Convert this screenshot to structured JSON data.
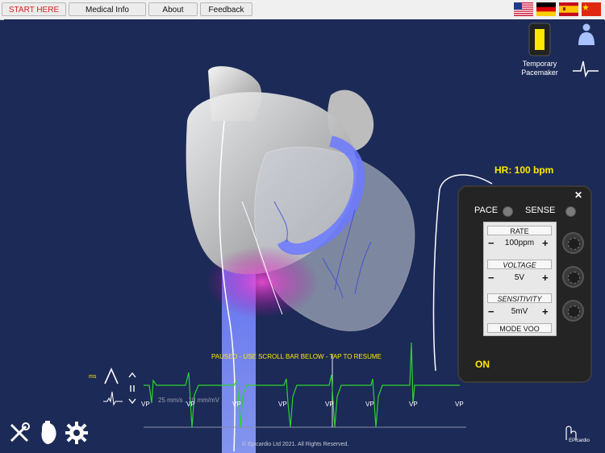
{
  "nav": {
    "start_here": "START HERE",
    "medical_info": "Medical Info",
    "about": "About",
    "feedback": "Feedback"
  },
  "flags": [
    "us-flag-icon",
    "de-flag-icon",
    "es-flag-icon",
    "cn-flag-icon"
  ],
  "side": {
    "temp_pacemaker_line1": "Temporary",
    "temp_pacemaker_line2": "Pacemaker"
  },
  "heart_rate": "HR: 100 bpm",
  "pacer": {
    "close": "✕",
    "pace_label": "PACE",
    "sense_label": "SENSE",
    "rate_label": "RATE",
    "rate_value": "100ppm",
    "voltage_label": "VOLTAGE",
    "voltage_value": "5V",
    "sensitivity_label": "SENSITIVITY",
    "sensitivity_value": "5mV",
    "mode_label": "MODE VOO",
    "on_label": "ON",
    "minus": "−",
    "plus": "+"
  },
  "ecg": {
    "paused_message": "PAUSED - USE SCROLL BAR BELOW - TAP TO RESUME",
    "ms_label": "ms",
    "speed_label": "25 mm/s , 10 mm/mV",
    "vp_markers": [
      "VP",
      "VP",
      "VP",
      "VP",
      "VP",
      "VP",
      "VP",
      "VP"
    ],
    "line_color": "#2bd42b"
  },
  "footer": {
    "copyright": "© Epicardio Ltd 2021. All Rights Reserved.",
    "logo_text": "EPicardio"
  },
  "colors": {
    "background": "#1c2a57",
    "accent_yellow": "#ffe800",
    "start_here_red": "#d81e1e"
  }
}
